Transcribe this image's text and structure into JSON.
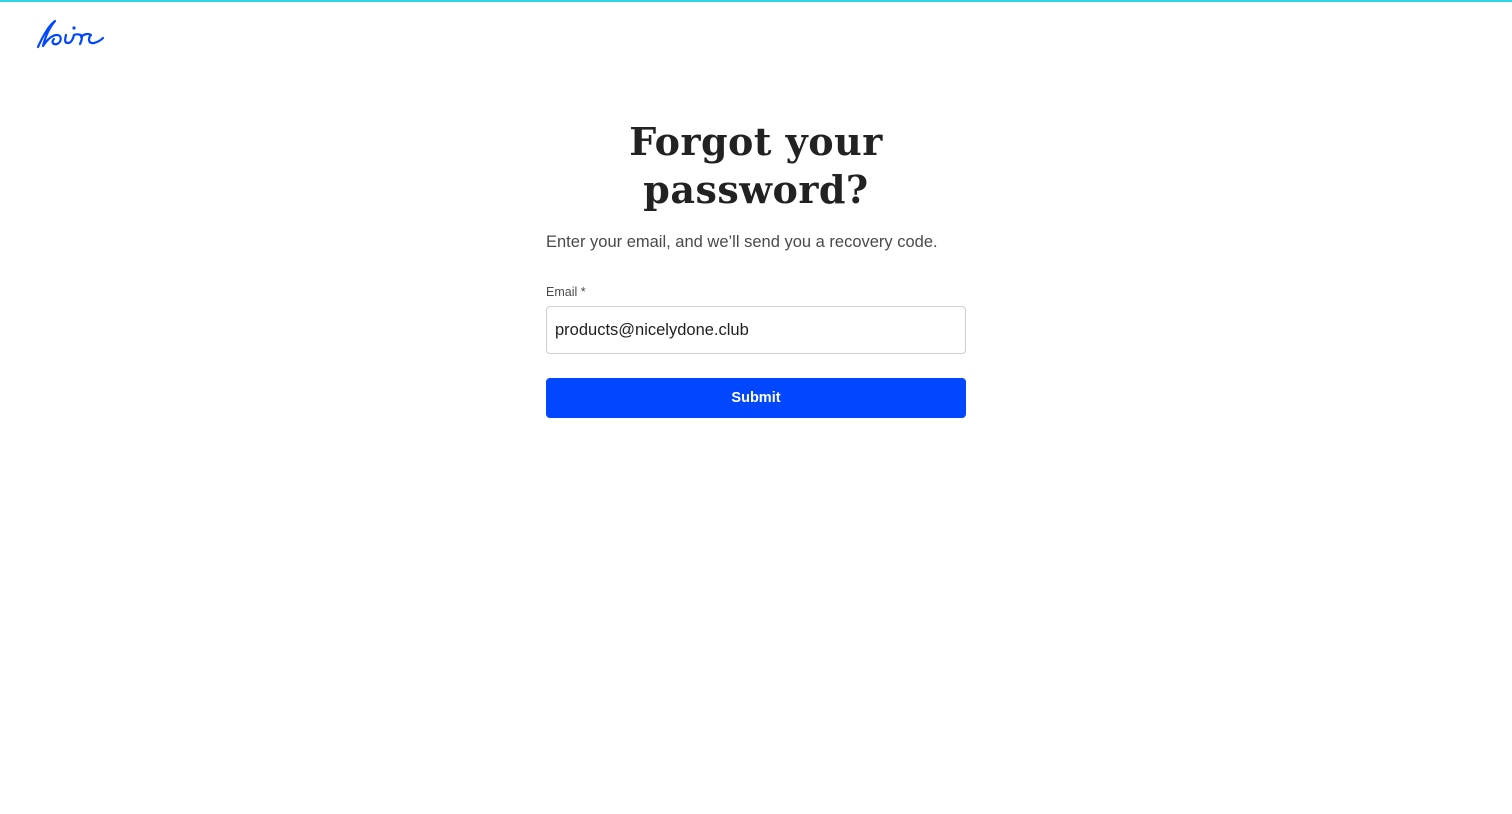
{
  "brand": {
    "logo_icon": "air-logo-icon",
    "logo_color": "#0147ff",
    "accent_color": "#2fd6e0"
  },
  "form": {
    "title_line1": "Forgot your",
    "title_line2": "password?",
    "subtitle": "Enter your email, and we’ll send you a recovery code.",
    "email_label": "Email *",
    "email_value": "products@nicelydone.club",
    "submit_label": "Submit",
    "button_color": "#0147ff"
  }
}
